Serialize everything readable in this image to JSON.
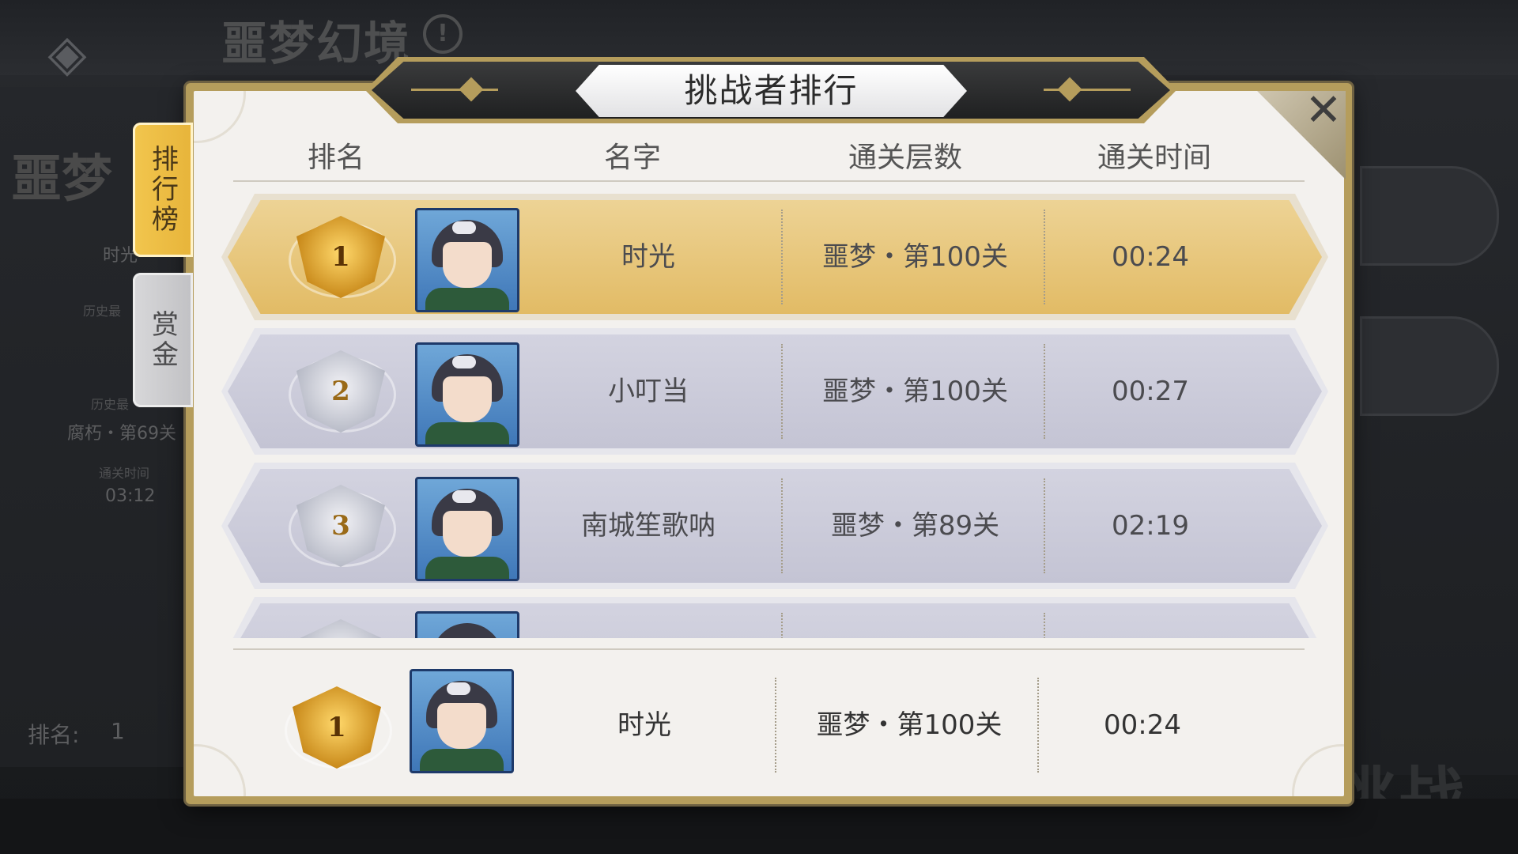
{
  "background": {
    "page_title": "噩梦幻境",
    "left_title": "噩梦",
    "left_label": "时光",
    "history_label_1": "历史最",
    "history_label_2": "历史最",
    "history_value": "腐朽・第69关",
    "clear_time_label": "通关时间",
    "clear_time_value": "03:12",
    "rank_label": "排名:",
    "rank_value": "1",
    "challenge_button": "挑战"
  },
  "modal": {
    "title": "挑战者排行",
    "tabs": [
      {
        "label": "排行榜",
        "active": true
      },
      {
        "label": "赏金",
        "active": false
      }
    ],
    "columns": [
      "排名",
      "名字",
      "通关层数",
      "通关时间"
    ],
    "rows": [
      {
        "rank": "1",
        "name": "时光",
        "floor": "噩梦・第100关",
        "time": "00:24",
        "tier": "gold"
      },
      {
        "rank": "2",
        "name": "小叮当",
        "floor": "噩梦・第100关",
        "time": "00:27",
        "tier": "silver"
      },
      {
        "rank": "3",
        "name": "南城笙歌呐",
        "floor": "噩梦・第89关",
        "time": "02:19",
        "tier": "silver"
      }
    ],
    "my_entry": {
      "rank": "1",
      "name": "时光",
      "floor": "噩梦・第100关",
      "time": "00:24"
    }
  },
  "colors": {
    "gold_row": "#e2bb65",
    "silver_row": "#c4c4d4",
    "modal_frame": "#b59d5c",
    "active_tab": "#f2c64e"
  },
  "icons": {
    "back": "diamond-back-icon",
    "info": "info-icon",
    "close": "close-icon",
    "medal_gold": "gold-medal-icon",
    "medal_silver": "silver-medal-icon",
    "avatar": "player-avatar-icon"
  }
}
